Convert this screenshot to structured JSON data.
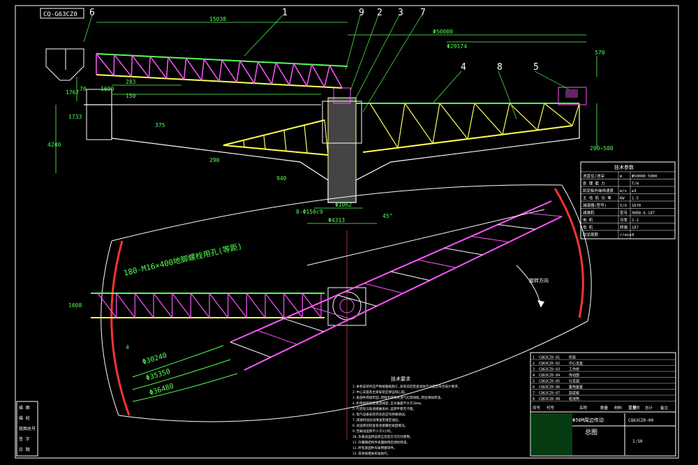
{
  "drawing": {
    "drawing_code": "CQ-G63CZ0",
    "balloons": [
      "6",
      "1",
      "9",
      "2",
      "3",
      "7",
      "4",
      "8",
      "5"
    ],
    "dimensions": {
      "top_span": "15038",
      "phi_outer": "Φ50000",
      "phi_inner": "Φ29174",
      "d_570": "570",
      "d_1767": "1767",
      "d_70": "70",
      "d_1690": "1690",
      "d_283": "283",
      "d_150": "150",
      "d_1733": "1733",
      "d_375": "375",
      "d_4240": "4240",
      "d_200_500": "200~500",
      "d_290": "290",
      "d_940": "940",
      "d_phi1062": "Φ1062",
      "d_phi4313": "Φ4313",
      "d_bolts": "8-Φ150c9",
      "d_45": "45°",
      "d_1608": "1608",
      "d_r30240": "Φ30240",
      "d_r35350": "Φ35350",
      "d_r36480": "Φ36480",
      "d_small": "4"
    },
    "plan_note": "180-M16×400地脚螺栓用孔(等距)",
    "rotation_label": "旋转方向"
  },
  "spec_table": {
    "title": "技术参数",
    "rows": [
      [
        "池直径/池深",
        "m",
        "Φ50000 5000"
      ],
      [
        "处 理 能 力",
        "",
        "T/H"
      ],
      [
        "刮泥板外缘线速度",
        "m/s",
        "≥3"
      ],
      [
        "主 电 机 功 率",
        "KW",
        "1.5"
      ],
      [
        "减速器(型号)",
        "I/O",
        "1670"
      ],
      [
        "减速机",
        "型号",
        "XWD8-6-187"
      ],
      [
        "电 机",
        "功率",
        "2.2"
      ],
      [
        "电 机",
        "转速",
        "187"
      ],
      [
        "刮泥周期",
        "r/min",
        "8"
      ]
    ]
  },
  "notes": {
    "title": "技术要求",
    "lines": [
      "1.本机安装时应严格按图纸施工,安装前应检查池体尺寸是否符合设计要求。",
      "2.中心支座及主梁安装应保证同心度。",
      "3.各部件焊接牢固,焊缝不得有夹渣气孔等缺陷,焊后清除焊渣。",
      "4.桁架组装后检查直线度,全长偏差不大于10mm。",
      "5.行走轮与轨道接触良好,运转平稳无卡阻。",
      "6.电气设备安装完毕后应作绝缘测试。",
      "7.减速机加注润滑油至规定油位。",
      "8.试运转前检查各连接螺栓紧固情况。",
      "9.空载试运转不少于2小时。",
      "10.负载试运转运转正常后方可交付使用。",
      "11.外露钢结构件表面除锈后涂防锈漆。",
      "12.所有紧固件均采用镀锌件。",
      "13.其余按相关标准执行。"
    ]
  },
  "title_block": {
    "parts": [
      [
        "1",
        "CQ63CZ0-01",
        "桁架"
      ],
      [
        "2",
        "CQ63CZ0-02",
        "中心支座"
      ],
      [
        "3",
        "CQ63CZ0-03",
        "工作桥"
      ],
      [
        "4",
        "CQ63CZ0-04",
        "传动部"
      ],
      [
        "5",
        "CQ63CZ0-05",
        "行走部"
      ],
      [
        "6",
        "CQ63CZ0-06",
        "集电装置"
      ],
      [
        "7",
        "CQ63CZ0-07",
        "刮泥板"
      ],
      [
        "8",
        "CQ63CZ0-08",
        "稳流筒"
      ]
    ],
    "header": [
      "序号",
      "代号",
      "名称",
      "数量",
      "材料",
      "单件",
      "总计",
      "备注"
    ],
    "weight_label": "重量",
    "project": "Φ50M周边传动",
    "drawing_name": "总图",
    "drawing_no": "CQ63CZ0-00",
    "scale": "1:50",
    "left_labels": [
      "描 图",
      "描 校",
      "底图总号",
      "签 字",
      "日 期"
    ]
  }
}
